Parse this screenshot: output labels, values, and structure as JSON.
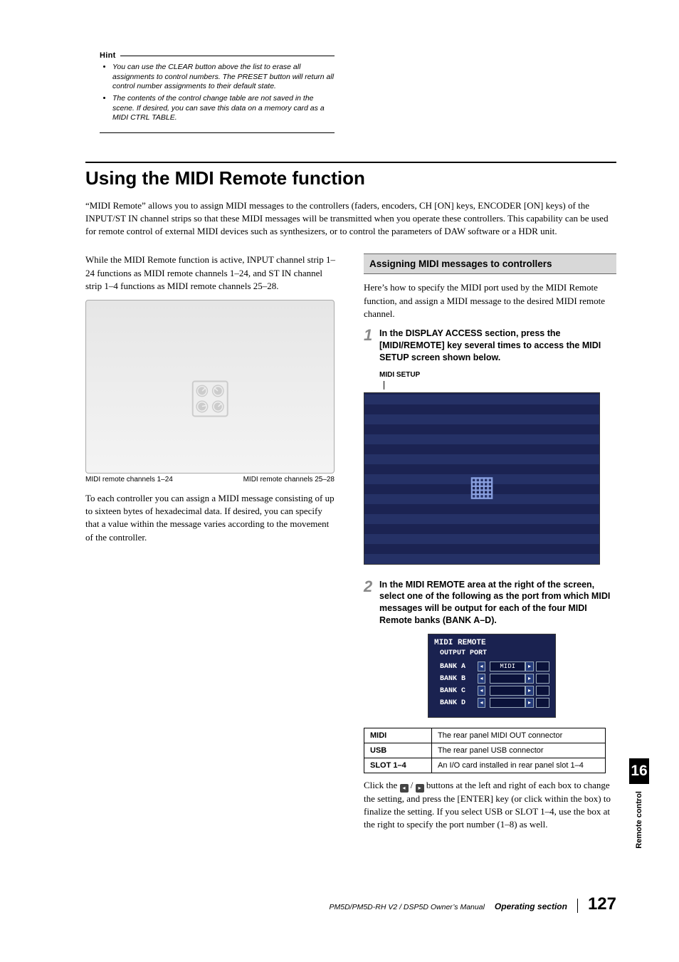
{
  "hint": {
    "title": "Hint",
    "items": [
      "You can use the CLEAR button above the list to erase all assignments to control numbers. The PRESET button will return all control number assignments to their default state.",
      "The contents of the control change table are not saved in the scene. If desired, you can save this data on a memory card as a MIDI CTRL TABLE."
    ]
  },
  "heading": "Using the MIDI Remote function",
  "intro": "“MIDI Remote” allows you to assign MIDI messages to the controllers (faders, encoders, CH [ON] keys, ENCODER [ON] keys) of the INPUT/ST IN channel strips so that these MIDI messages will be transmitted when you operate these controllers. This capability can be used for remote control of external MIDI devices such as synthesizers, or to control the parameters of DAW software or a HDR unit.",
  "left": {
    "p1": "While the MIDI Remote function is active, INPUT channel strip 1–24 functions as MIDI remote channels 1–24, and ST IN channel strip 1–4 functions as MIDI remote channels 25–28.",
    "cap_left": "MIDI remote channels 1–24",
    "cap_right": "MIDI remote channels 25–28",
    "p2": "To each controller you can assign a MIDI message consisting of up to sixteen bytes of hexadecimal data. If desired, you can specify that a value within the message varies according to the movement of the controller."
  },
  "right": {
    "sub": "Assigning MIDI messages to controllers",
    "p1": "Here’s how to specify the MIDI port used by the MIDI Remote function, and assign a MIDI message to the desired MIDI remote channel.",
    "step1": "In the DISPLAY ACCESS section, press the [MIDI/REMOTE] key several times to access the MIDI SETUP screen shown below.",
    "screen_label": "MIDI SETUP",
    "step2": "In the MIDI REMOTE area at the right of the screen, select one of the following as the port from which MIDI messages will be output for each of the four MIDI Remote banks (BANK A–D).",
    "panel": {
      "title": "MIDI REMOTE",
      "sub": "OUTPUT PORT",
      "banks": [
        "BANK A",
        "BANK B",
        "BANK C",
        "BANK D"
      ],
      "sel": "MIDI"
    },
    "table": [
      {
        "k": "MIDI",
        "v": "The rear panel MIDI OUT connector"
      },
      {
        "k": "USB",
        "v": "The rear panel USB connector"
      },
      {
        "k": "SLOT 1–4",
        "v": "An I/O card installed in rear panel slot 1–4"
      }
    ],
    "p2_a": "Click the ",
    "p2_b": " / ",
    "p2_c": " buttons at the left and right of each box to change the setting, and press the [ENTER] key (or click within the box) to finalize the setting. If you select USB or SLOT 1–4, use the box at the right to specify the port number (1–8) as well."
  },
  "sidebar": {
    "chapter": "16",
    "label": "Remote control"
  },
  "footer": {
    "manual": "PM5D/PM5D-RH V2 / DSP5D Owner’s Manual",
    "section": "Operating section",
    "page": "127"
  }
}
